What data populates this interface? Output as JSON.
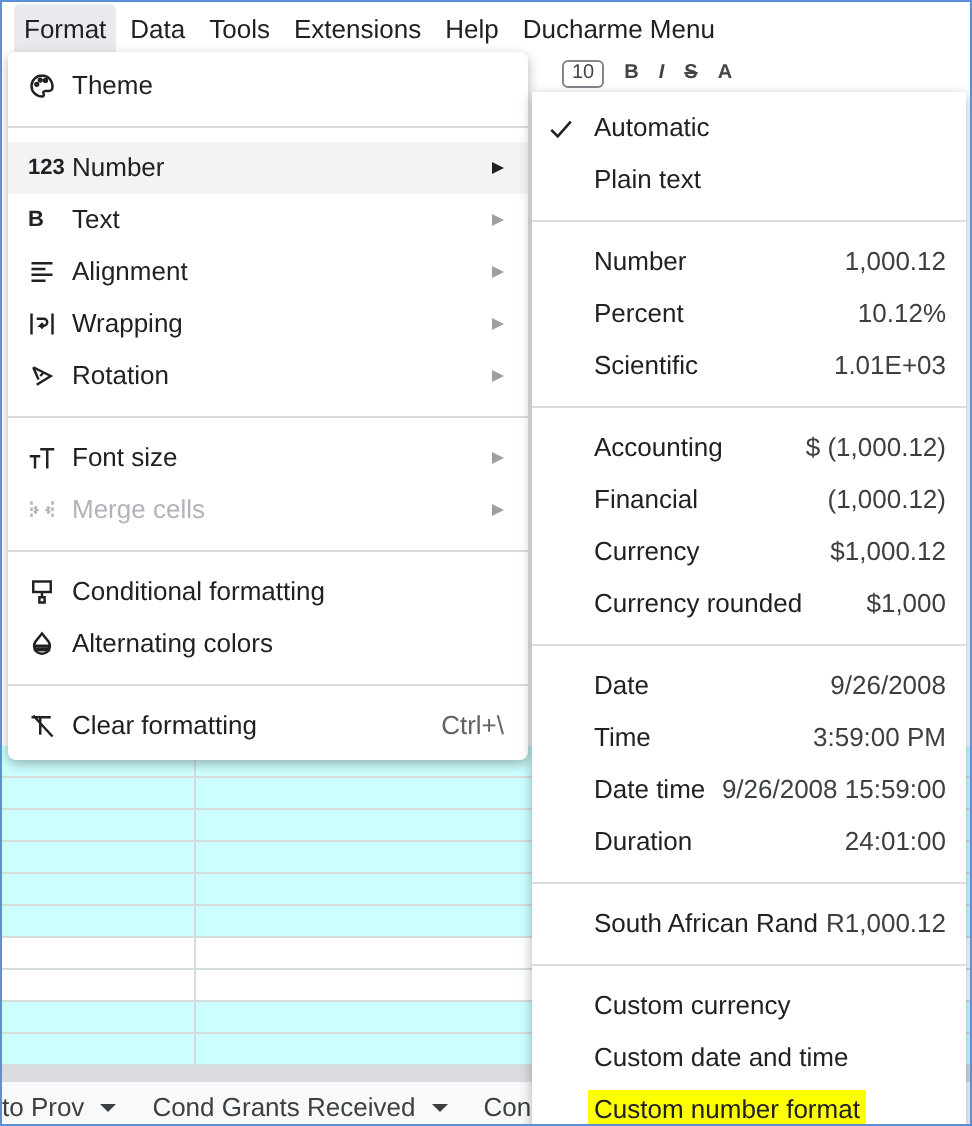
{
  "menu_bar": [
    {
      "label": "Format",
      "selected": true
    },
    {
      "label": "Data",
      "selected": false
    },
    {
      "label": "Tools",
      "selected": false
    },
    {
      "label": "Extensions",
      "selected": false
    },
    {
      "label": "Help",
      "selected": false
    },
    {
      "label": "Ducharme Menu",
      "selected": false
    }
  ],
  "toolbar": {
    "font_size": "10",
    "buttons": [
      "B",
      "I",
      "S",
      "A"
    ]
  },
  "format_menu": {
    "groups": [
      [
        {
          "label": "Theme",
          "submenu": false,
          "selected": false,
          "disabled": false
        }
      ],
      [
        {
          "label": "Number",
          "icon_text": "123",
          "submenu": true,
          "selected": true,
          "disabled": false
        },
        {
          "label": "Text",
          "icon_text": "B",
          "submenu": true,
          "selected": false,
          "disabled": false
        },
        {
          "label": "Alignment",
          "submenu": true,
          "selected": false,
          "disabled": false
        },
        {
          "label": "Wrapping",
          "submenu": true,
          "selected": false,
          "disabled": false
        },
        {
          "label": "Rotation",
          "submenu": true,
          "selected": false,
          "disabled": false
        }
      ],
      [
        {
          "label": "Font size",
          "submenu": true,
          "selected": false,
          "disabled": false
        },
        {
          "label": "Merge cells",
          "submenu": true,
          "selected": false,
          "disabled": true
        }
      ],
      [
        {
          "label": "Conditional formatting",
          "submenu": false,
          "selected": false,
          "disabled": false
        },
        {
          "label": "Alternating colors",
          "submenu": false,
          "selected": false,
          "disabled": false
        }
      ],
      [
        {
          "label": "Clear formatting",
          "shortcut": "Ctrl+\\",
          "submenu": false,
          "selected": false,
          "disabled": false
        }
      ]
    ]
  },
  "number_submenu": {
    "groups": [
      [
        {
          "label": "Automatic",
          "checked": true,
          "highlighted": false
        },
        {
          "label": "Plain text",
          "checked": false,
          "highlighted": false
        }
      ],
      [
        {
          "label": "Number",
          "example": "1,000.12",
          "checked": false,
          "highlighted": false
        },
        {
          "label": "Percent",
          "example": "10.12%",
          "checked": false,
          "highlighted": false
        },
        {
          "label": "Scientific",
          "example": "1.01E+03",
          "checked": false,
          "highlighted": false
        }
      ],
      [
        {
          "label": "Accounting",
          "example": "$ (1,000.12)",
          "checked": false,
          "highlighted": false
        },
        {
          "label": "Financial",
          "example": "(1,000.12)",
          "checked": false,
          "highlighted": false
        },
        {
          "label": "Currency",
          "example": "$1,000.12",
          "checked": false,
          "highlighted": false
        },
        {
          "label": "Currency rounded",
          "example": "$1,000",
          "checked": false,
          "highlighted": false
        }
      ],
      [
        {
          "label": "Date",
          "example": "9/26/2008",
          "checked": false,
          "highlighted": false
        },
        {
          "label": "Time",
          "example": "3:59:00 PM",
          "checked": false,
          "highlighted": false
        },
        {
          "label": "Date time",
          "example": "9/26/2008 15:59:00",
          "checked": false,
          "highlighted": false
        },
        {
          "label": "Duration",
          "example": "24:01:00",
          "checked": false,
          "highlighted": false
        }
      ],
      [
        {
          "label": "South African Rand",
          "example": "R1,000.12",
          "checked": false,
          "highlighted": false
        }
      ],
      [
        {
          "label": "Custom currency",
          "checked": false,
          "highlighted": false
        },
        {
          "label": "Custom date and time",
          "checked": false,
          "highlighted": false
        },
        {
          "label": "Custom number format",
          "checked": false,
          "highlighted": true
        }
      ]
    ]
  },
  "sheet_tabs": [
    {
      "label": "to Prov",
      "selected": false
    },
    {
      "label": "Cond Grants Received",
      "selected": false
    },
    {
      "label": "Con",
      "selected": false
    }
  ]
}
